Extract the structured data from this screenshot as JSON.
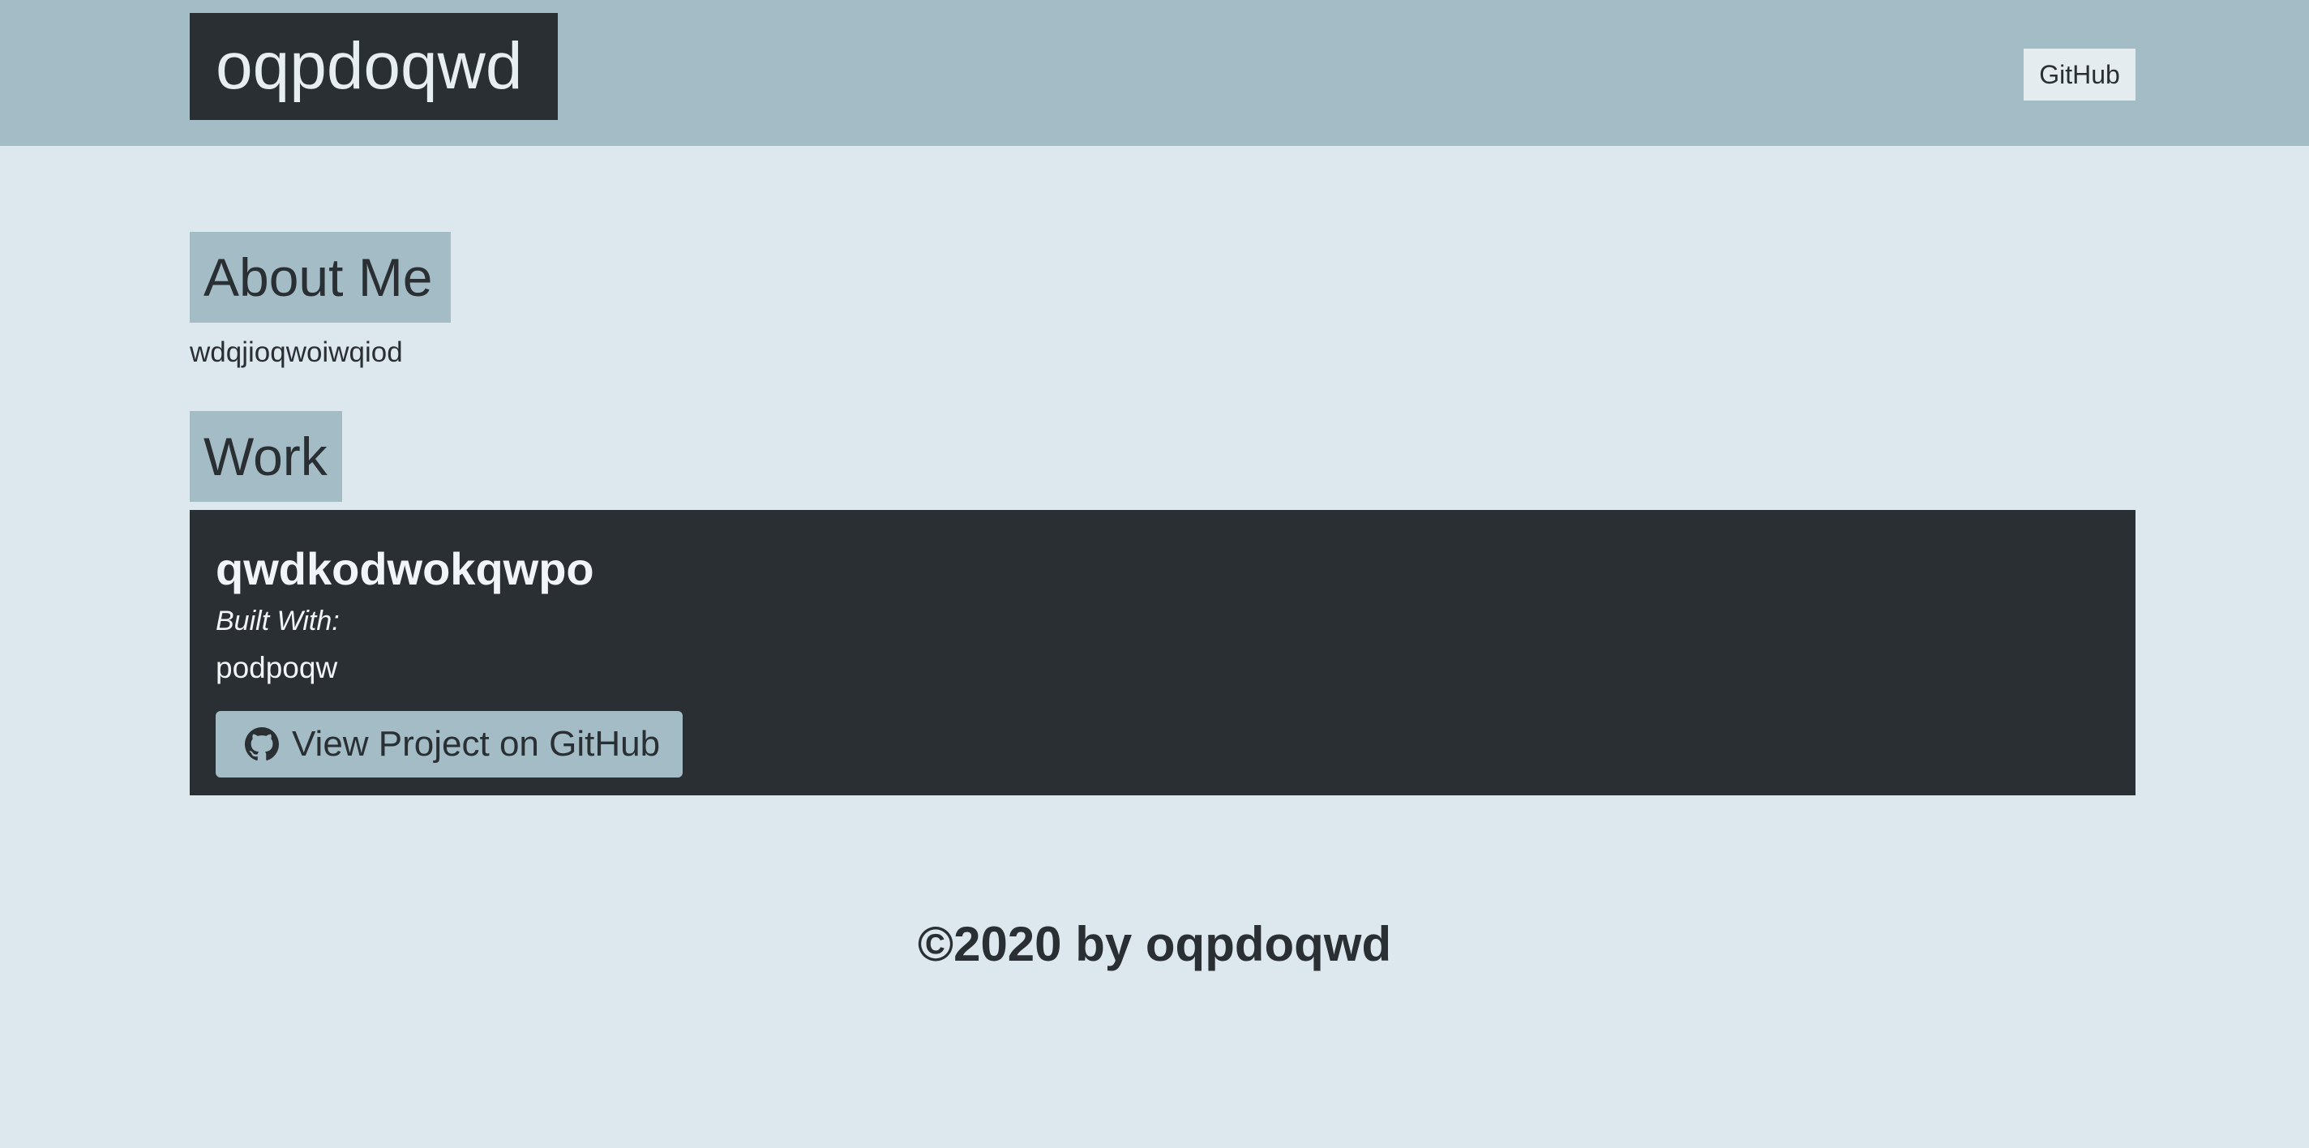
{
  "header": {
    "logo_text": "oqpdoqwd",
    "nav": {
      "github_label": "GitHub"
    }
  },
  "about": {
    "heading": "About Me",
    "text": "wdqjioqwoiwqiod"
  },
  "work": {
    "heading": "Work",
    "projects": [
      {
        "title": "qwdkodwokqwpo",
        "built_with_label": "Built With:",
        "tech": "podpoqw",
        "button_label": "View Project on GitHub",
        "button_icon": "github-icon"
      }
    ]
  },
  "footer": {
    "text": "©2020 by oqpdoqwd"
  },
  "colors": {
    "page_bg": "#dde8ee",
    "header_bg": "#a3bcc6",
    "dark": "#2a2f33",
    "accent": "#a3bcc6"
  }
}
